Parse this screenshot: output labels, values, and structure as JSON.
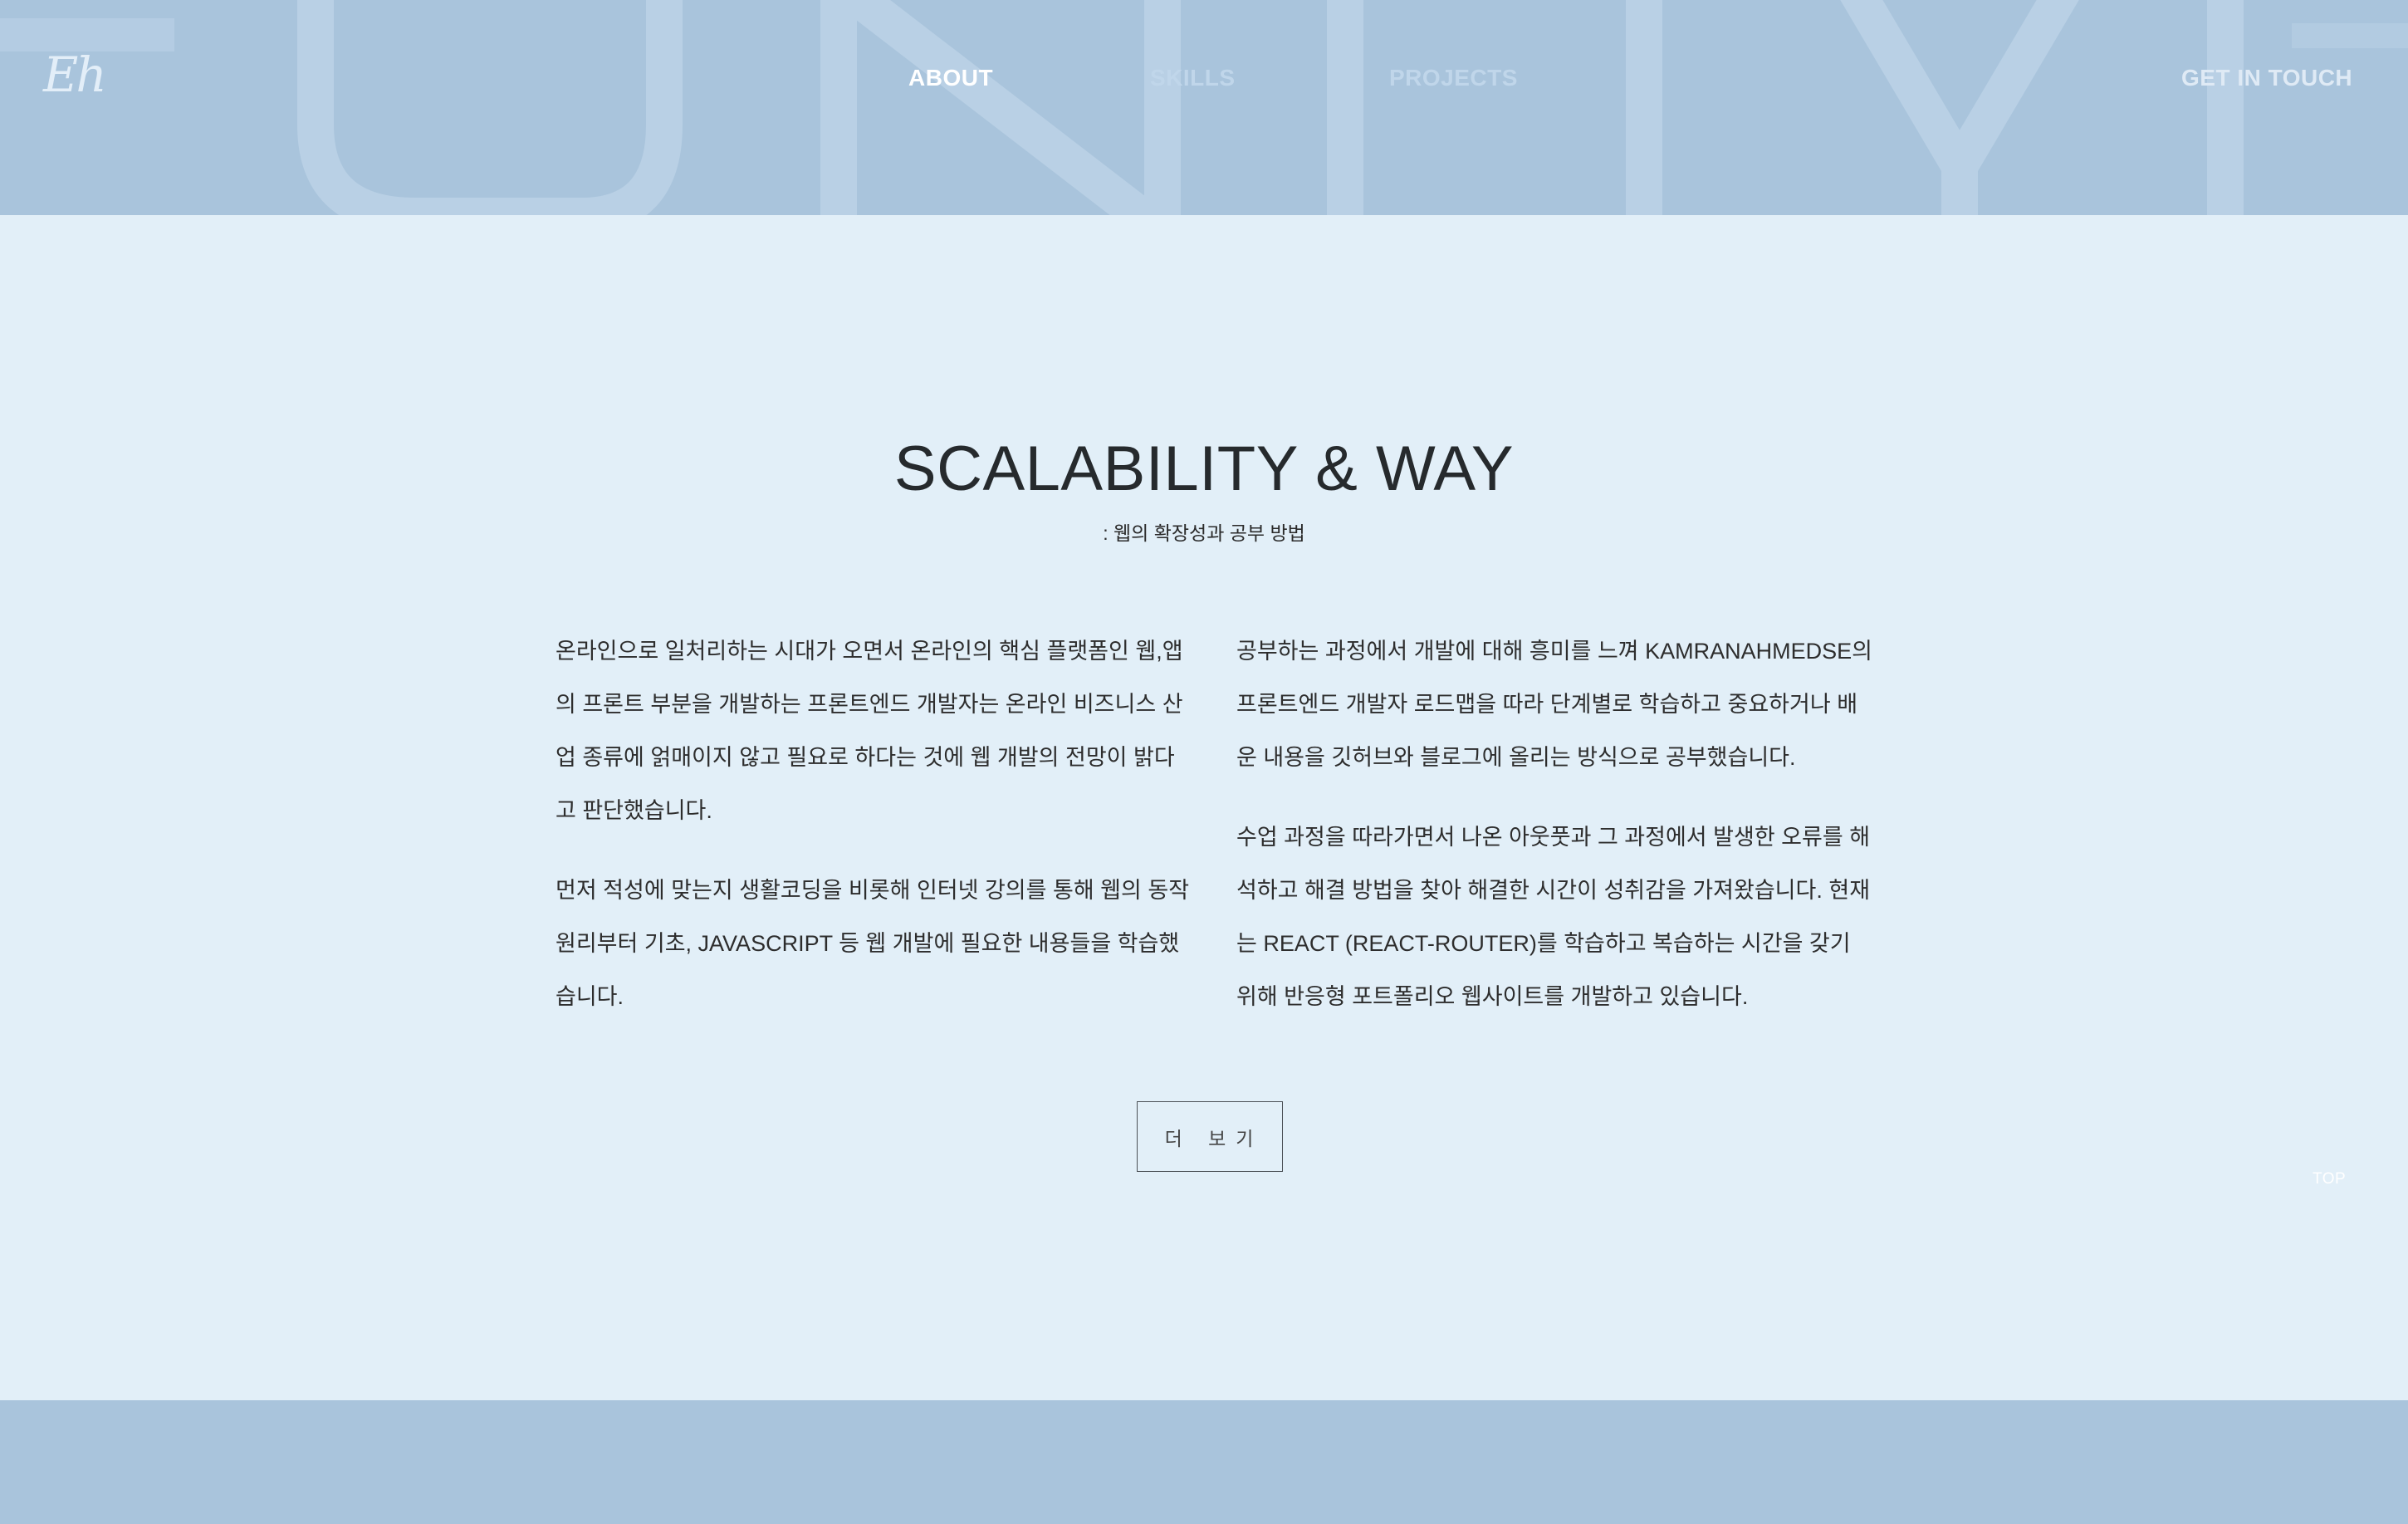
{
  "header": {
    "logo": "Eh",
    "nav": {
      "about": "ABOUT",
      "skills": "SKILLS",
      "projects": "PROJECTS",
      "contact": "GET IN TOUCH"
    },
    "background_color": "#a9c4dc"
  },
  "section": {
    "title": "SCALABILITY & WAY",
    "subtitle": ": 웹의 확장성과 공부 방법",
    "left_paragraphs": [
      "온라인으로 일처리하는 시대가 오면서 온라인의 핵심 플랫폼인 웹,앱의 프론트 부분을 개발하는 프론트엔드 개발자는 온라인 비즈니스 산업 종류에 얽매이지 않고 필요로 하다는 것에 웹 개발의 전망이 밝다고 판단했습니다.",
      "먼저 적성에 맞는지 생활코딩을 비롯해 인터넷 강의를 통해 웹의 동작 원리부터 기초, JAVASCRIPT 등 웹 개발에 필요한 내용들을 학습했습니다."
    ],
    "right_paragraphs": [
      "공부하는 과정에서 개발에 대해 흥미를 느껴 KAMRANAHMEDSE의 프론트엔드 개발자 로드맵을 따라 단계별로 학습하고 중요하거나 배운 내용을 깃허브와 블로그에 올리는 방식으로 공부했습니다.",
      "수업 과정을 따라가면서 나온 아웃풋과 그 과정에서 발생한 오류를 해석하고 해결 방법을 찾아 해결한 시간이 성취감을 가져왔습니다. 현재는 REACT (REACT-ROUTER)를 학습하고 복습하는 시간을 갖기 위해 반응형 포트폴리오 웹사이트를 개발하고 있습니다."
    ],
    "more_button": "더 보기",
    "background_color": "#e2eff8"
  },
  "top_link": "TOP"
}
